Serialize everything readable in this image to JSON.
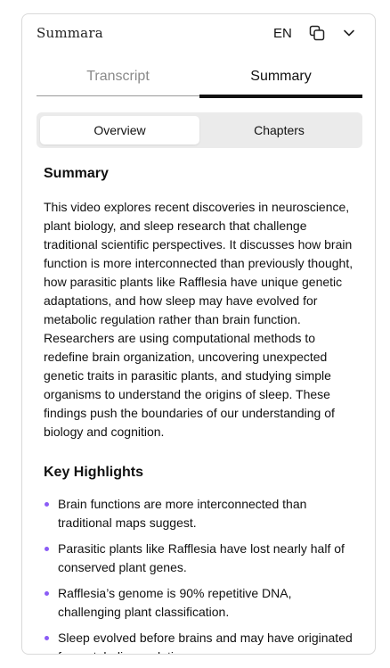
{
  "header": {
    "brand": "Summara",
    "language": "EN",
    "copy_icon": "copy-icon",
    "collapse_icon": "chevron-down-icon"
  },
  "tabs": [
    {
      "label": "Transcript",
      "active": false
    },
    {
      "label": "Summary",
      "active": true
    }
  ],
  "segmented": {
    "overview": "Overview",
    "chapters": "Chapters",
    "selected": "Overview"
  },
  "summary": {
    "title": "Summary",
    "text": "This video explores recent discoveries in neuroscience, plant biology, and sleep research that challenge traditional scientific perspectives. It discusses how brain function is more interconnected than previously thought, how parasitic plants like Rafflesia have unique genetic adaptations, and how sleep may have evolved for metabolic regulation rather than brain function. Researchers are using computational methods to redefine brain organization, uncovering unexpected genetic traits in parasitic plants, and studying simple organisms to understand the origins of sleep. These findings push the boundaries of our understanding of biology and cognition."
  },
  "highlights": {
    "title": "Key Highlights",
    "items": [
      "Brain functions are more interconnected than traditional maps suggest.",
      "Parasitic plants like Rafflesia have lost nearly half of conserved plant genes.",
      "Rafflesia’s genome is 90% repetitive DNA, challenging plant classification.",
      "Sleep evolved before brains and may have originated for metabolic regulation."
    ]
  },
  "colors": {
    "bullet": "#8b5cf6",
    "active_tab": "#111111",
    "inactive_tab": "#8a8a8a",
    "segment_bg": "#ebebeb"
  }
}
